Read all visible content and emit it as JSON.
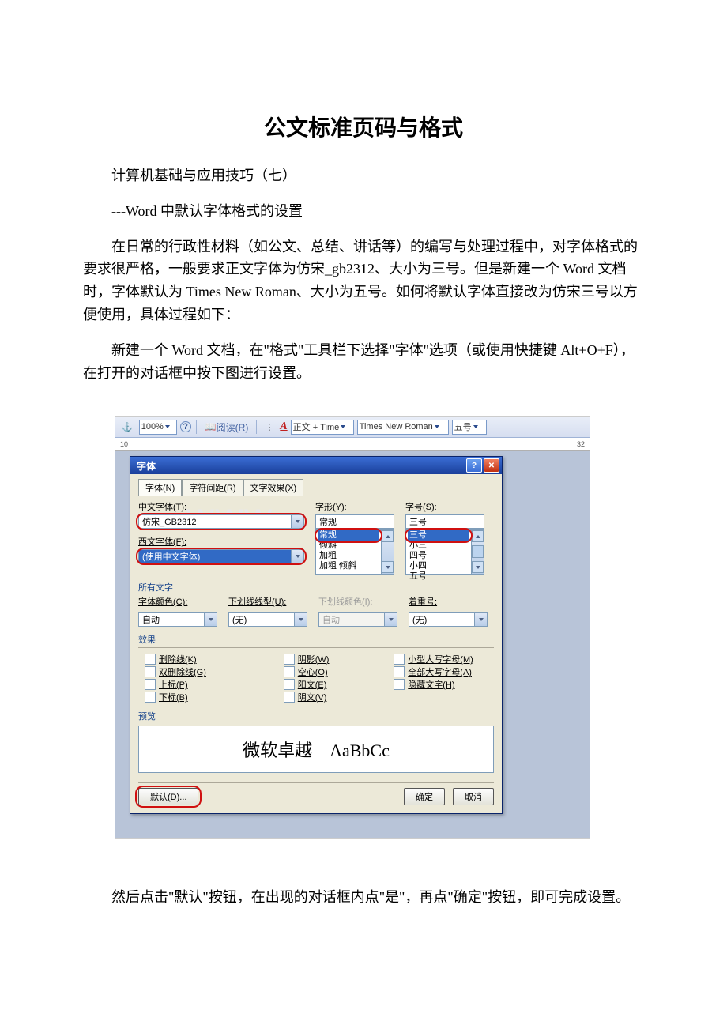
{
  "doc": {
    "title": "公文标准页码与格式",
    "line1": "计算机基础与应用技巧（七）",
    "line2": "---Word 中默认字体格式的设置",
    "para1": "在日常的行政性材料（如公文、总结、讲话等）的编写与处理过程中，对字体格式的要求很严格，一般要求正文字体为仿宋_gb2312、大小为三号。但是新建一个 Word 文档时，字体默认为 Times New Roman、大小为五号。如何将默认字体直接改为仿宋三号以方便使用，具体过程如下：",
    "para2": "新建一个 Word 文档，在\"格式\"工具栏下选择\"字体\"选项（或使用快捷键 Alt+O+F），在打开的对话框中按下图进行设置。",
    "para3": "然后点击\"默认\"按钮，在出现的对话框内点\"是\"，再点\"确定\"按钮，即可完成设置。"
  },
  "toolbar": {
    "zoom": "100%",
    "read": "阅读(R)",
    "style": "正文 + Time",
    "font": "Times New Roman",
    "size": "五号"
  },
  "ruler": {
    "left": "10",
    "right": "32"
  },
  "dialog": {
    "title": "字体",
    "tabs": {
      "t1": "字体(N)",
      "t2": "字符间距(R)",
      "t3": "文字效果(X)"
    },
    "labels": {
      "cnfont": "中文字体(T):",
      "enfont": "西文字体(F):",
      "style": "字形(Y):",
      "size": "字号(S):",
      "section_all": "所有文字",
      "color": "字体颜色(C):",
      "uline": "下划线线型(U):",
      "ucolor": "下划线颜色(I):",
      "emph": "着重号:",
      "section_fx": "效果",
      "section_pv": "预览"
    },
    "values": {
      "cnfont": "仿宋_GB2312",
      "enfont": "(使用中文字体)",
      "style_sel": "常规",
      "size_sel": "三号",
      "color": "自动",
      "uline": "(无)",
      "ucolor": "自动",
      "emph": "(无)"
    },
    "style_list": [
      "常规",
      "倾斜",
      "加粗",
      "加粗 倾斜"
    ],
    "size_list": [
      "三号",
      "小三",
      "四号",
      "小四",
      "五号"
    ],
    "fx": {
      "c1a": "删除线(K)",
      "c1b": "双删除线(G)",
      "c1c": "上标(P)",
      "c1d": "下标(B)",
      "c2a": "阴影(W)",
      "c2b": "空心(O)",
      "c2c": "阳文(E)",
      "c2d": "阴文(V)",
      "c3a": "小型大写字母(M)",
      "c3b": "全部大写字母(A)",
      "c3c": "隐藏文字(H)"
    },
    "preview": "微软卓越　AaBbCc",
    "buttons": {
      "def": "默认(D)...",
      "ok": "确定",
      "cancel": "取消"
    }
  }
}
